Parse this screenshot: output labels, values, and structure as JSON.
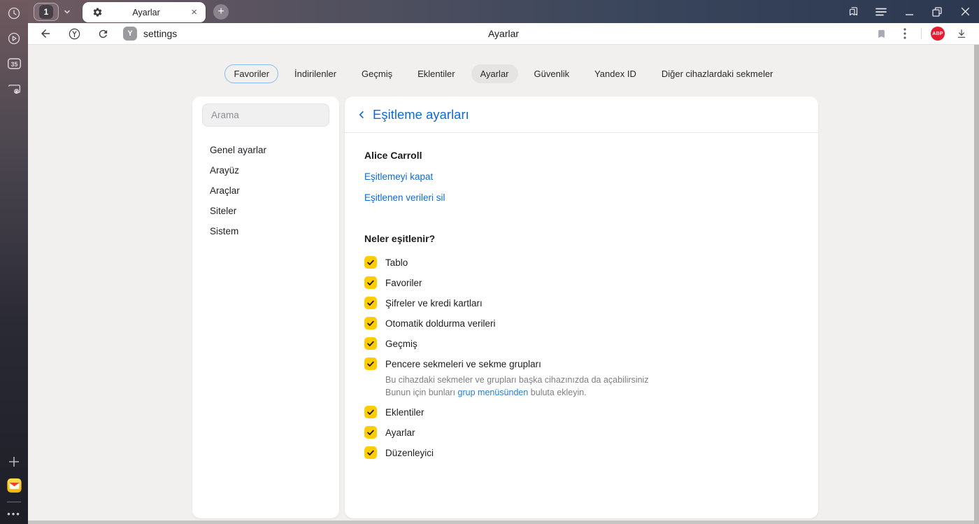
{
  "titlebar": {
    "tab_group_count": "1",
    "tab_title": "Ayarlar",
    "tab_close": "×",
    "new_tab": "+"
  },
  "toolbar": {
    "url": "settings",
    "page_title": "Ayarlar",
    "site_badge": "Y",
    "y_button": "Y"
  },
  "left_rail": {
    "tab_counter": "35",
    "more_dots": "•••"
  },
  "extensions": {
    "abp_label": "ABP"
  },
  "nav": {
    "tabs": [
      {
        "label": "Favoriler",
        "state": "outlined"
      },
      {
        "label": "İndirilenler",
        "state": "normal"
      },
      {
        "label": "Geçmiş",
        "state": "normal"
      },
      {
        "label": "Eklentiler",
        "state": "normal"
      },
      {
        "label": "Ayarlar",
        "state": "selected"
      },
      {
        "label": "Güvenlik",
        "state": "normal"
      },
      {
        "label": "Yandex ID",
        "state": "normal"
      },
      {
        "label": "Diğer cihazlardaki sekmeler",
        "state": "normal"
      }
    ]
  },
  "settings_nav": {
    "search_placeholder": "Arama",
    "items": [
      "Genel ayarlar",
      "Arayüz",
      "Araçlar",
      "Siteler",
      "Sistem"
    ]
  },
  "sync": {
    "title": "Eşitleme ayarları",
    "account_name": "Alice Carroll",
    "links": {
      "disable": "Eşitlemeyi kapat",
      "delete": "Eşitlenen verileri sil"
    },
    "section_title": "Neler eşitlenir?",
    "items": [
      {
        "label": "Tablo",
        "checked": true
      },
      {
        "label": "Favoriler",
        "checked": true
      },
      {
        "label": "Şifreler ve kredi kartları",
        "checked": true
      },
      {
        "label": "Otomatik doldurma verileri",
        "checked": true
      },
      {
        "label": "Geçmiş",
        "checked": true
      },
      {
        "label": "Pencere sekmeleri ve sekme grupları",
        "checked": true,
        "description_line1": "Bu cihazdaki sekmeler ve grupları başka cihazınızda da açabilirsiniz",
        "description_line2_prefix": "Bunun için bunları ",
        "description_line2_link": "grup menüsünden",
        "description_line2_suffix": " buluta ekleyin."
      },
      {
        "label": "Eklentiler",
        "checked": true
      },
      {
        "label": "Ayarlar",
        "checked": true
      },
      {
        "label": "Düzenleyici",
        "checked": true
      }
    ]
  },
  "colors": {
    "accent_blue": "#0f6bd3",
    "checkbox_yellow": "#ffcc00",
    "abp_red": "#e01f30",
    "titlebar_left": "#6e5a60",
    "titlebar_right": "#2b3850"
  }
}
